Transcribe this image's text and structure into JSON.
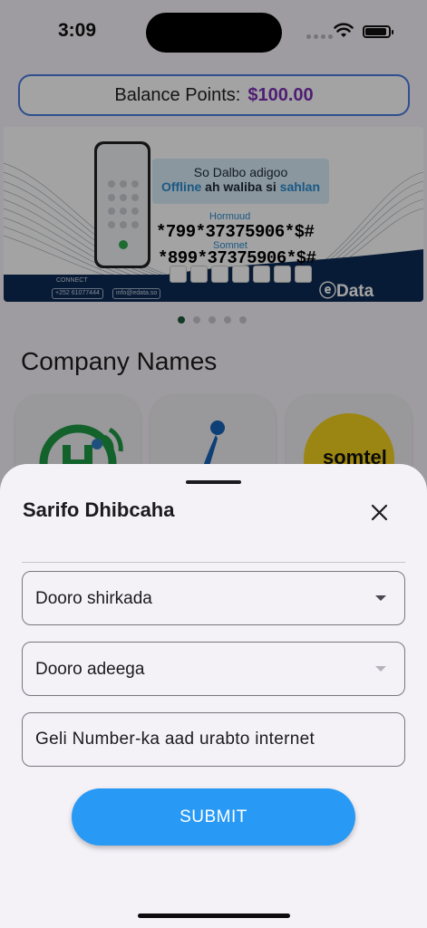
{
  "status_bar": {
    "time": "3:09"
  },
  "balance": {
    "label": "Balance Points:",
    "value": "$100.00"
  },
  "banner": {
    "promo_line1": "So Dalbo adigoo",
    "promo_word1": "Offline",
    "promo_word2": " ah waliba si ",
    "promo_word3": "sahlan",
    "operator1": "Hormuud",
    "code1": "*799*37375906*$#",
    "operator2": "Somnet",
    "code2": "*899*37375906*$#",
    "connect": "CONNECT",
    "phone": "+252 61077444",
    "email": "info@edata.so",
    "brand": "Data"
  },
  "carousel": {
    "count": 5,
    "active": 0
  },
  "section": {
    "title": "Company Names"
  },
  "sheet": {
    "title": "Sarifo Dhibcaha",
    "company_select": "Dooro shirkada",
    "service_select": "Dooro adeega",
    "number_placeholder": "Geli Number-ka aad urabto internet",
    "submit_label": "SUBMIT"
  },
  "colors": {
    "accent": "#2899f5",
    "balance_value": "#7b2fb5",
    "border_blue": "#4a7ce2"
  }
}
